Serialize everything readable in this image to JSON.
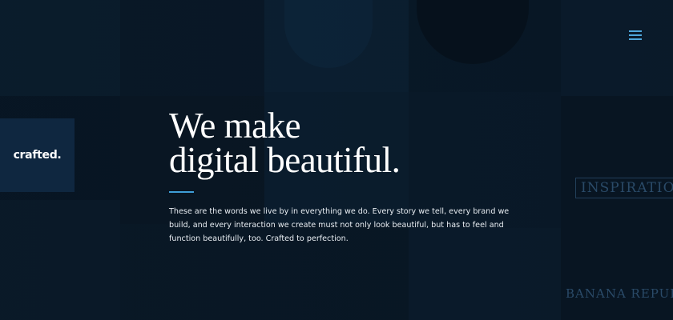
{
  "brand": {
    "logo": "crafted."
  },
  "nav": {
    "menu_icon": "hamburger-icon"
  },
  "hero": {
    "headline_line1": "We make",
    "headline_line2": "digital beautiful.",
    "body": "These are the words we live by in everything we do. Every story we tell, every brand we build, and every interaction we create must not only look beautiful, but has to feel and function beautifully, too. Crafted to perfection."
  },
  "background": {
    "text1": "INSPIRATION",
    "text2": "BANANA REPUBLIC"
  },
  "colors": {
    "accent": "#3f9ed8",
    "logo_box": "#0f2740"
  }
}
